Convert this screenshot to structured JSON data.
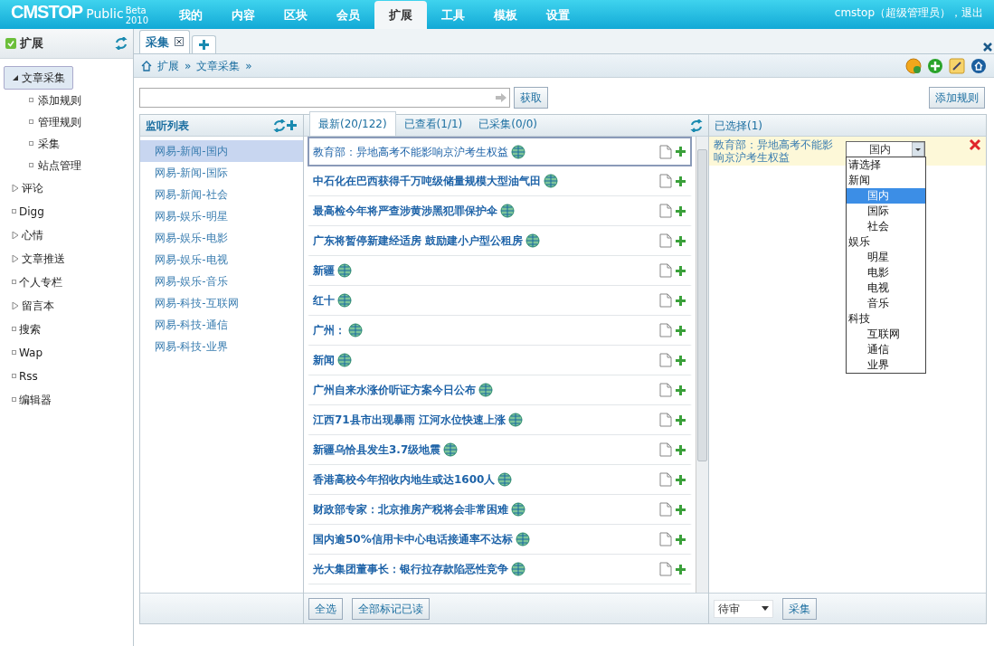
{
  "topbar": {
    "logo": "CMSTOP",
    "edition": "Public",
    "beta": "Beta",
    "year": "2010",
    "menu": [
      {
        "label": "我的",
        "selected": false
      },
      {
        "label": "内容",
        "selected": false
      },
      {
        "label": "区块",
        "selected": false
      },
      {
        "label": "会员",
        "selected": false
      },
      {
        "label": "扩展",
        "selected": true
      },
      {
        "label": "工具",
        "selected": false
      },
      {
        "label": "模板",
        "selected": false
      },
      {
        "label": "设置",
        "selected": false
      }
    ],
    "user": "cmstop（超级管理员），退出"
  },
  "sidebar": {
    "title": "扩展",
    "items": [
      {
        "label": "文章采集",
        "kind": "folder",
        "expanded": true,
        "selected": true,
        "children": [
          {
            "label": "添加规则"
          },
          {
            "label": "管理规则"
          },
          {
            "label": "采集"
          },
          {
            "label": "站点管理"
          }
        ]
      },
      {
        "label": "评论",
        "kind": "folder",
        "expanded": false,
        "selected": false
      },
      {
        "label": "Digg",
        "kind": "leaf",
        "selected": false
      },
      {
        "label": "心情",
        "kind": "folder",
        "expanded": false,
        "selected": false
      },
      {
        "label": "文章推送",
        "kind": "folder",
        "expanded": false,
        "selected": false
      },
      {
        "label": "个人专栏",
        "kind": "leaf",
        "selected": false
      },
      {
        "label": "留言本",
        "kind": "folder",
        "expanded": false,
        "selected": false
      },
      {
        "label": "搜索",
        "kind": "leaf",
        "selected": false
      },
      {
        "label": "Wap",
        "kind": "leaf",
        "selected": false
      },
      {
        "label": "Rss",
        "kind": "leaf",
        "selected": false
      },
      {
        "label": "编辑器",
        "kind": "leaf",
        "selected": false
      }
    ]
  },
  "page_tabs": [
    {
      "label": "采集",
      "selected": true
    }
  ],
  "breadcrumb": {
    "items": [
      "扩展",
      "文章采集"
    ],
    "separator": "»"
  },
  "toolbar": {
    "fetch_button": "获取",
    "add_rule_button": "添加规则"
  },
  "watch_list": {
    "title": "监听列表",
    "items": [
      {
        "label": "网易-新闻-国内",
        "selected": true
      },
      {
        "label": "网易-新闻-国际",
        "selected": false
      },
      {
        "label": "网易-新闻-社会",
        "selected": false
      },
      {
        "label": "网易-娱乐-明星",
        "selected": false
      },
      {
        "label": "网易-娱乐-电影",
        "selected": false
      },
      {
        "label": "网易-娱乐-电视",
        "selected": false
      },
      {
        "label": "网易-娱乐-音乐",
        "selected": false
      },
      {
        "label": "网易-科技-互联网",
        "selected": false
      },
      {
        "label": "网易-科技-通信",
        "selected": false
      },
      {
        "label": "网易-科技-业界",
        "selected": false
      }
    ]
  },
  "feed": {
    "tabs": [
      {
        "label": "最新(20/122)",
        "selected": true
      },
      {
        "label": "已查看(1/1)",
        "selected": false
      },
      {
        "label": "已采集(0/0)",
        "selected": false
      }
    ],
    "items": [
      {
        "title": "教育部：异地高考不能影响京沪考生权益",
        "read": true,
        "selected": true
      },
      {
        "title": "中石化在巴西获得千万吨级储量规模大型油气田",
        "read": false,
        "selected": false
      },
      {
        "title": "最高检今年将严查涉黄涉黑犯罪保护伞",
        "read": false,
        "selected": false
      },
      {
        "title": "广东将暂停新建经适房 鼓励建小户型公租房",
        "read": false,
        "selected": false
      },
      {
        "title": "新疆",
        "read": false,
        "selected": false
      },
      {
        "title": "红十",
        "read": false,
        "selected": false
      },
      {
        "title": "广州：",
        "read": false,
        "selected": false
      },
      {
        "title": "新闻",
        "read": false,
        "selected": false
      },
      {
        "title": "广州自来水涨价听证方案今日公布",
        "read": false,
        "selected": false
      },
      {
        "title": "江西71县市出现暴雨 江河水位快速上涨",
        "read": false,
        "selected": false
      },
      {
        "title": "新疆乌恰县发生3.7级地震",
        "read": false,
        "selected": false
      },
      {
        "title": "香港高校今年招收内地生或达1600人",
        "read": false,
        "selected": false
      },
      {
        "title": "财政部专家：北京推房产税将会非常困难",
        "read": false,
        "selected": false
      },
      {
        "title": "国内逾50%信用卡中心电话接通率不达标",
        "read": false,
        "selected": false
      },
      {
        "title": "光大集团董事长：银行拉存款陷恶性竞争",
        "read": false,
        "selected": false
      }
    ],
    "buttons": [
      "全选",
      "全部标记已读"
    ]
  },
  "selected_panel": {
    "title": "已选择(1)",
    "items": [
      {
        "title": "教育部：异地高考不能影响京沪考生权益",
        "category": "国内"
      }
    ],
    "dropdown_options": [
      {
        "label": "请选择",
        "kind": "group",
        "selected": false
      },
      {
        "label": "新闻",
        "kind": "group",
        "selected": false
      },
      {
        "label": "国内",
        "kind": "option",
        "selected": true
      },
      {
        "label": "国际",
        "kind": "option",
        "selected": false
      },
      {
        "label": "社会",
        "kind": "option",
        "selected": false
      },
      {
        "label": "娱乐",
        "kind": "group",
        "selected": false
      },
      {
        "label": "明星",
        "kind": "option",
        "selected": false
      },
      {
        "label": "电影",
        "kind": "option",
        "selected": false
      },
      {
        "label": "电视",
        "kind": "option",
        "selected": false
      },
      {
        "label": "音乐",
        "kind": "option",
        "selected": false
      },
      {
        "label": "科技",
        "kind": "group",
        "selected": false
      },
      {
        "label": "互联网",
        "kind": "option",
        "selected": false
      },
      {
        "label": "通信",
        "kind": "option",
        "selected": false
      },
      {
        "label": "业界",
        "kind": "option",
        "selected": false
      }
    ],
    "status_select": "待审",
    "collect_button": "采集"
  }
}
